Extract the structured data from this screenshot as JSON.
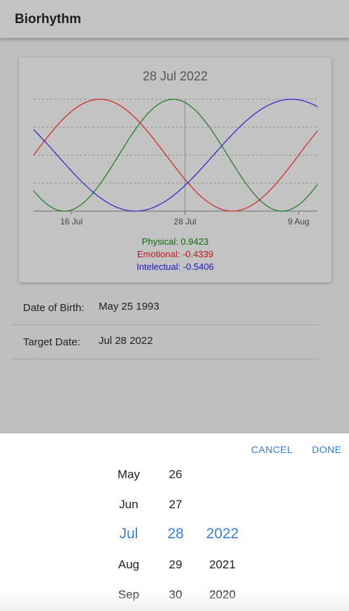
{
  "header": {
    "title": "Biorhythm"
  },
  "card": {
    "title": "28 Jul 2022",
    "legend": {
      "physical": "Physical: 0.9423",
      "emotional": "Emotional: -0.4339",
      "intellectual": "Intelectual: -0.5406"
    }
  },
  "form": {
    "dob_label": "Date of Birth:",
    "dob_value": "May 25 1993",
    "target_label": "Target Date:",
    "target_value": "Jul 28 2022"
  },
  "picker": {
    "cancel_label": "CANCEL",
    "done_label": "DONE",
    "months": [
      "May",
      "Jun",
      "Jul",
      "Aug",
      "Sep"
    ],
    "days": [
      "26",
      "27",
      "28",
      "29",
      "30"
    ],
    "years": [
      "",
      "",
      "2022",
      "2021",
      "2020"
    ],
    "selected_index": 2
  },
  "chart_data": {
    "type": "line",
    "x_ticks": [
      "16 Jul",
      "28 Jul",
      "9 Aug"
    ],
    "series": [
      {
        "name": "Physical",
        "period": 23,
        "color": "#1a7a1a"
      },
      {
        "name": "Emotional",
        "period": 28,
        "color": "#d42020"
      },
      {
        "name": "Intelectual",
        "period": 33,
        "color": "#2020d4"
      }
    ],
    "birth_date": "1993-05-25",
    "x_range": [
      "2022-07-12",
      "2022-08-11"
    ],
    "target_date": "2022-07-28",
    "ylim": [
      -1,
      1
    ],
    "grid": true
  }
}
